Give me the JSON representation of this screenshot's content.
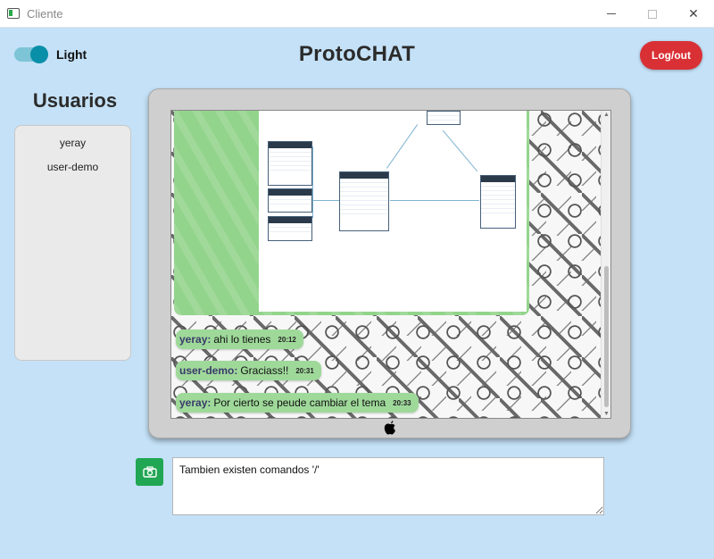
{
  "window": {
    "title": "Cliente"
  },
  "header": {
    "theme_label": "Light",
    "app_title": "ProtoCHAT",
    "logout_label": "Log/out"
  },
  "sidebar": {
    "title": "Usuarios",
    "users": [
      "yeray",
      "user-demo"
    ]
  },
  "chat": {
    "messages": [
      {
        "user": "yeray:",
        "text": "ahi lo tienes",
        "time": "20:12"
      },
      {
        "user": "user-demo:",
        "text": "Graciass!!",
        "time": "20:31"
      },
      {
        "user": "yeray:",
        "text": "Por cierto se peude cambiar el tema",
        "time": "20:33"
      }
    ]
  },
  "composer": {
    "value": "Tambien existen comandos '/'"
  },
  "colors": {
    "background": "#c4e1f7",
    "logout": "#d93036",
    "bubble": "#9fd99a",
    "camera_button": "#21a653",
    "toggle": "#0a8fa8"
  },
  "icons": {
    "window": "app-window-icon",
    "camera": "camera-icon",
    "monitor_logo": "apple-icon"
  }
}
